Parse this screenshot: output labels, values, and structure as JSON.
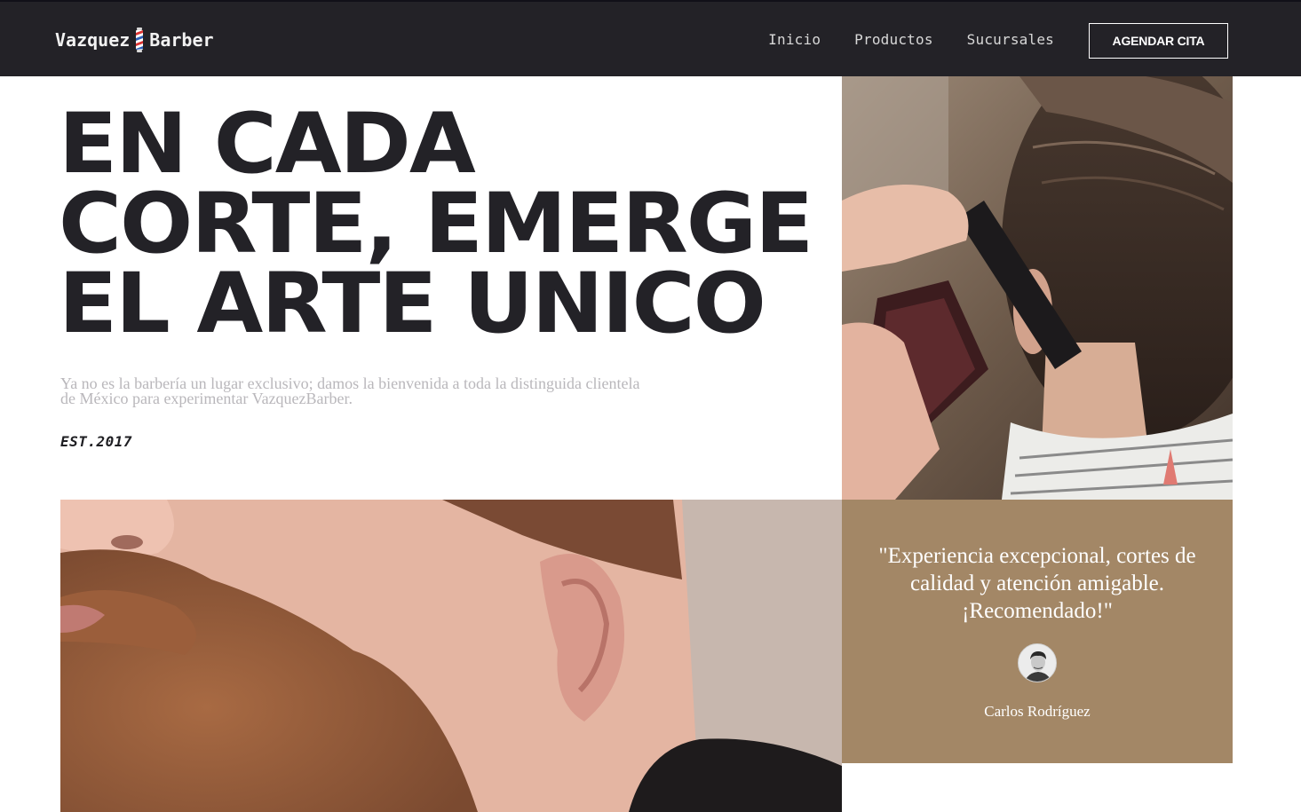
{
  "nav": {
    "brand_left": "Vazquez",
    "brand_right": "Barber",
    "links": [
      "Inicio",
      "Productos",
      "Sucursales"
    ],
    "cta": "AGENDAR CITA"
  },
  "hero": {
    "headline_lines": [
      "EN CADA",
      "CORTE, EMERGE",
      "EL ARTE UNICO"
    ],
    "subtitle": "Ya no es la barbería un lugar exclusivo; damos la bienvenida a toda la distinguida clientela de México para experimentar VazquezBarber.",
    "established": "EST.2017"
  },
  "testimonial": {
    "quote": "\"Experiencia excepcional, cortes de calidad y atención amigable. ¡Recomendado!\"",
    "author": "Carlos Rodríguez"
  },
  "colors": {
    "nav_bg": "#232227",
    "headline": "#232227",
    "testimonial_bg": "#a38766",
    "subtitle": "#b9b7bb"
  }
}
